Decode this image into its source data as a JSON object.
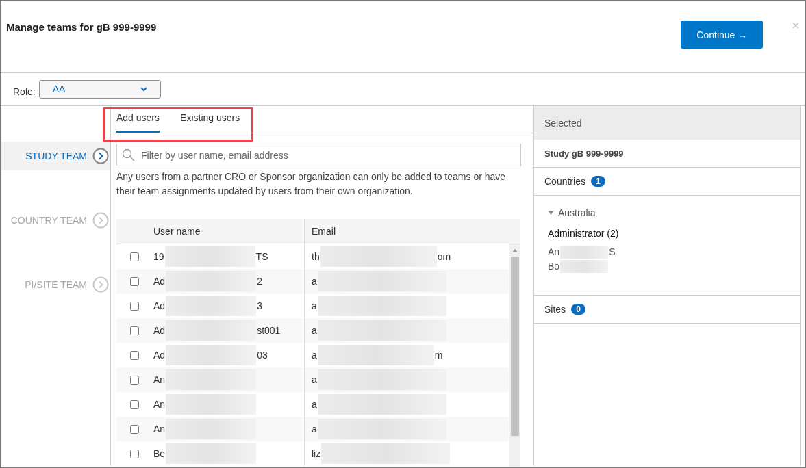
{
  "dialog": {
    "title": "Manage teams for gB 999-9999",
    "continue_button": "Continue →",
    "close": "×"
  },
  "role": {
    "label": "Role:",
    "value": "AA"
  },
  "teams": [
    {
      "label": "STUDY TEAM",
      "selected": true,
      "disabled": false
    },
    {
      "label": "COUNTRY TEAM",
      "selected": false,
      "disabled": true
    },
    {
      "label": "PI/SITE TEAM",
      "selected": false,
      "disabled": true
    }
  ],
  "tabs_highlighted": true,
  "tabs": [
    {
      "label": "Add users",
      "selected": true
    },
    {
      "label": "Existing users",
      "selected": false
    }
  ],
  "search": {
    "placeholder": "Filter by user name, email address"
  },
  "notice": "Any users from a partner CRO or Sponsor organization can only be added to teams or have their team assignments updated by users from their own organization.",
  "table": {
    "columns": [
      "User name",
      "Email"
    ],
    "rows": [
      {
        "checked": false,
        "user_name": {
          "start": "19",
          "end": "TS"
        },
        "email": {
          "start": "th",
          "end": "om"
        }
      },
      {
        "checked": false,
        "user_name": {
          "start": "Ad",
          "end": "2"
        },
        "email": {
          "start": "a"
        }
      },
      {
        "checked": false,
        "user_name": {
          "start": "Ad",
          "end": "3"
        },
        "email": {
          "start": "a"
        }
      },
      {
        "checked": false,
        "user_name": {
          "start": "Ad",
          "end": "st001"
        },
        "email": {
          "start": "a"
        }
      },
      {
        "checked": false,
        "user_name": {
          "start": "Ad",
          "end": "03"
        },
        "email": {
          "start": "a",
          "end": "m"
        }
      },
      {
        "checked": false,
        "user_name": {
          "start": "An"
        },
        "email": {
          "start": "a"
        }
      },
      {
        "checked": false,
        "user_name": {
          "start": "An"
        },
        "email": {
          "start": "a"
        }
      },
      {
        "checked": false,
        "user_name": {
          "start": "An"
        },
        "email": {
          "start": "a"
        }
      },
      {
        "checked": false,
        "user_name": {
          "start": "Be"
        },
        "email": {
          "start": "liz"
        }
      }
    ]
  },
  "selected_panel": {
    "title": "Selected",
    "study": "Study gB 999-9999",
    "countries": {
      "label": "Countries",
      "count": "1"
    },
    "country_groups": [
      {
        "name": "Australia",
        "expanded": true,
        "roles": [
          {
            "label": "Administrator (2)",
            "members": [
              {
                "start": "An",
                "end": "S"
              },
              {
                "start": "Bo"
              }
            ]
          }
        ]
      }
    ],
    "sites": {
      "label": "Sites",
      "count": "0"
    }
  }
}
